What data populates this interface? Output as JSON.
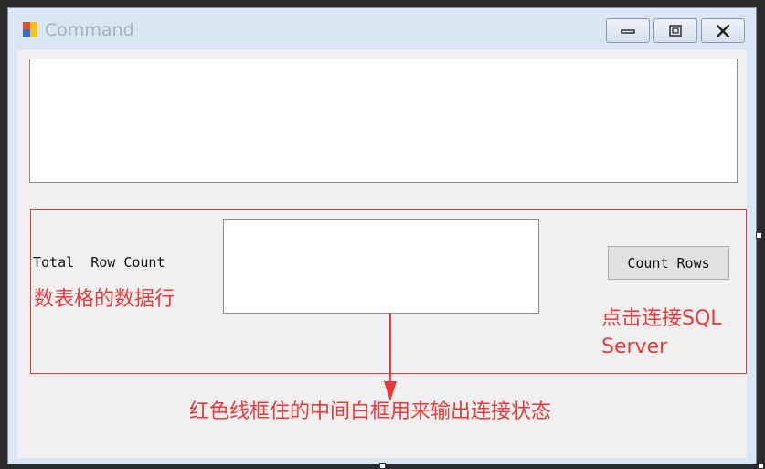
{
  "window": {
    "title": "Command"
  },
  "controls": {
    "total_label": "Total  Row Count",
    "count_button_label": "Count Rows"
  },
  "annotations": {
    "left_note": "数表格的数据行",
    "right_note_line1": "点击连接SQL",
    "right_note_line2": "Server",
    "bottom_note": "红色线框住的中间白框用来输出连接状态"
  },
  "colors": {
    "annotation_red": "#e83a3a",
    "client_bg": "#f0f0f0",
    "frame_bg": "#dbe6f4"
  }
}
